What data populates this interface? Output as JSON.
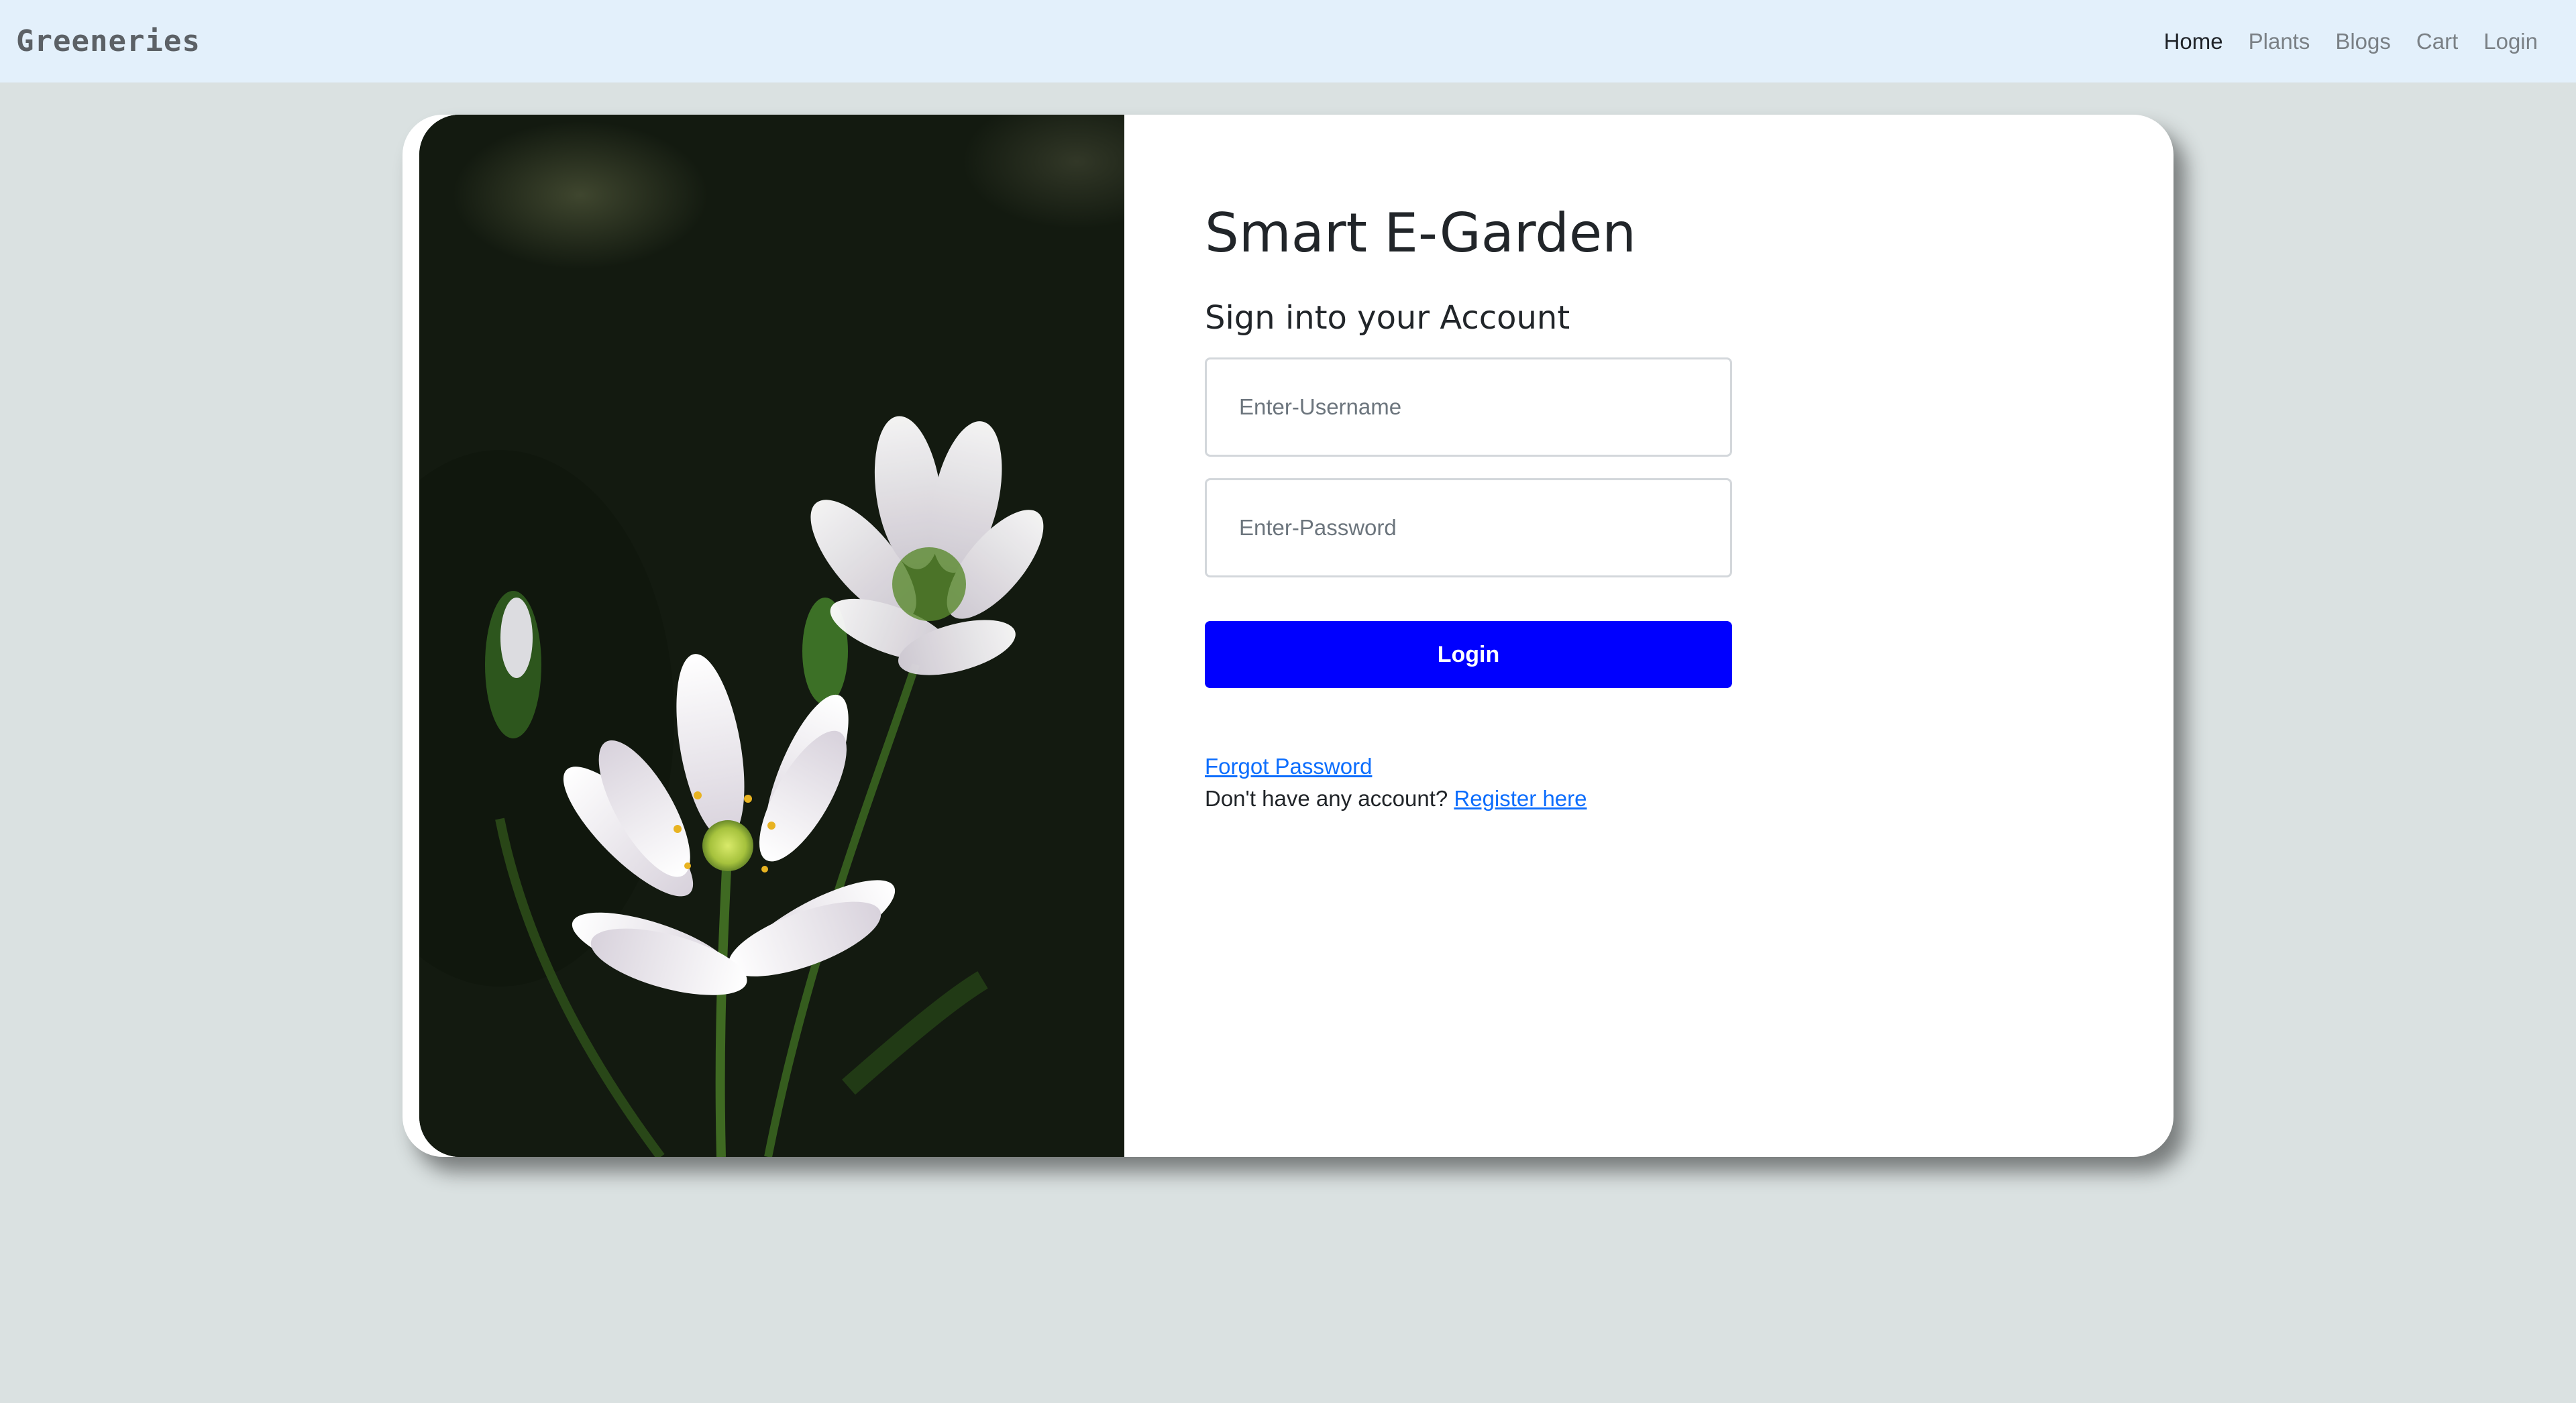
{
  "navbar": {
    "brand": "Greeneries",
    "links": [
      {
        "label": "Home",
        "active": true
      },
      {
        "label": "Plants",
        "active": false
      },
      {
        "label": "Blogs",
        "active": false
      },
      {
        "label": "Cart",
        "active": false
      },
      {
        "label": "Login",
        "active": false
      }
    ]
  },
  "login": {
    "title": "Smart E-Garden",
    "subtitle": "Sign into your Account",
    "username_placeholder": "Enter-Username",
    "username_value": "",
    "password_placeholder": "Enter-Password",
    "password_value": "",
    "login_button": "Login",
    "forgot_password": "Forgot Password",
    "no_account_text": "Don't have any account?",
    "register_link": "Register here"
  },
  "image": {
    "subject": "white-flowers-photo"
  },
  "colors": {
    "navbar_bg": "#e3f0fb",
    "page_bg": "#dae1e1",
    "button_bg": "#0000ff",
    "link": "#0d6efd"
  }
}
